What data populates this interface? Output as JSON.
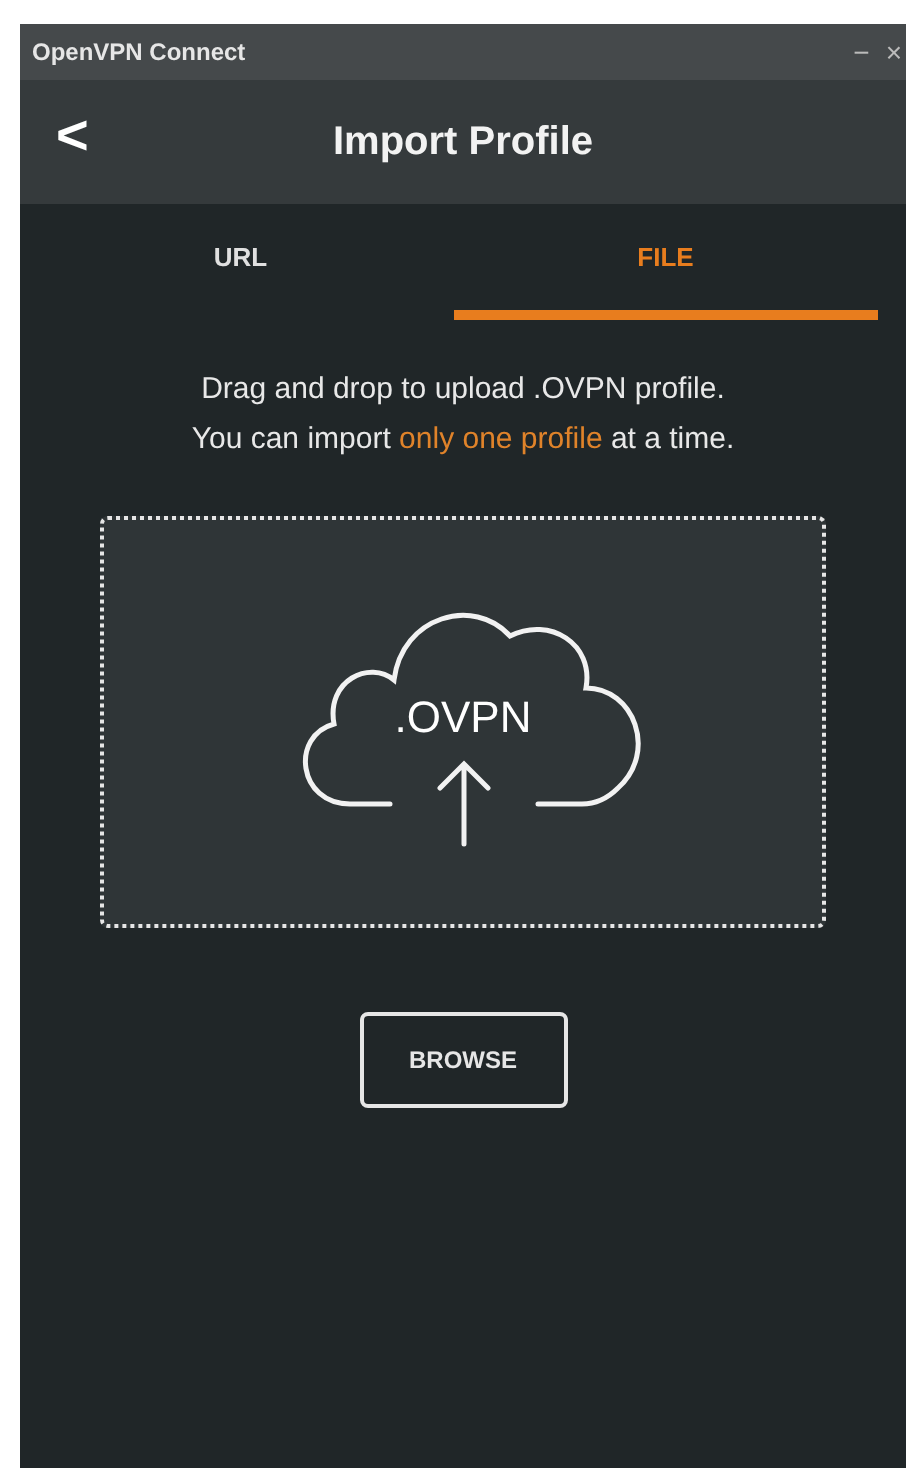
{
  "window": {
    "title": "OpenVPN Connect",
    "controls": [
      "−",
      "×"
    ]
  },
  "header": {
    "back": "<",
    "title": "Import Profile"
  },
  "tabs": [
    {
      "label": "URL",
      "selected": false
    },
    {
      "label": "FILE",
      "selected": true
    }
  ],
  "instructions": [
    {
      "parts": [
        {
          "text": "Drag and drop to upload .OVPN profile.",
          "highlight": false
        }
      ]
    },
    {
      "parts": [
        {
          "text": "You can import ",
          "highlight": false
        },
        {
          "text": "only one profile",
          "highlight": true
        },
        {
          "text": " at a time.",
          "highlight": false
        }
      ]
    }
  ],
  "drop_zone": {
    "label": ".OVPN"
  },
  "browse_button": "BROWSE"
}
